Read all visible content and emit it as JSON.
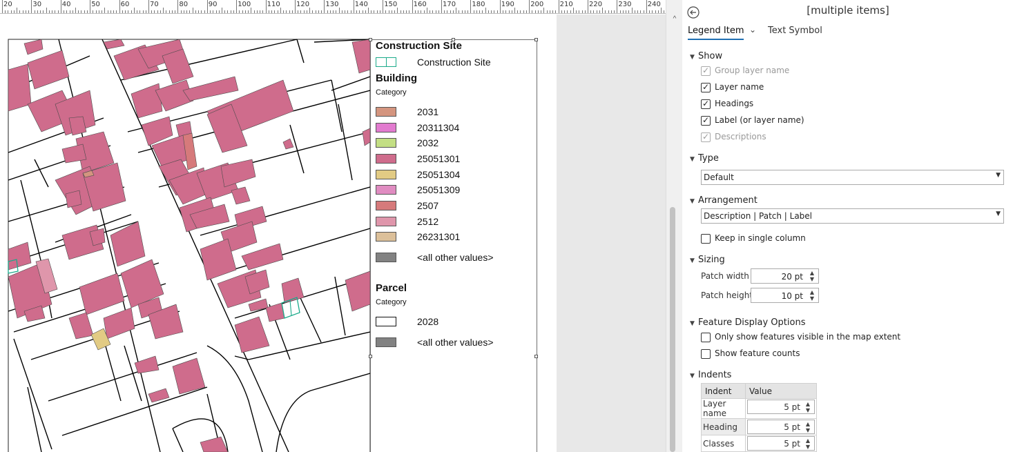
{
  "ruler": {
    "labels": [
      "20",
      "30",
      "40",
      "50",
      "60",
      "70",
      "80",
      "90",
      "100",
      "110",
      "120",
      "130",
      "140",
      "150",
      "160",
      "170",
      "180",
      "190",
      "200",
      "210",
      "220",
      "230",
      "240"
    ]
  },
  "legend": {
    "construction_title": "Construction Site",
    "construction_item": "Construction Site",
    "building_title": "Building",
    "building_heading": "Category",
    "building_items": [
      {
        "label": "2031",
        "color": "#d4957f"
      },
      {
        "label": "20311304",
        "color": "#e27bcf"
      },
      {
        "label": "2032",
        "color": "#c3df84"
      },
      {
        "label": "25051301",
        "color": "#cf6c8c"
      },
      {
        "label": "25051304",
        "color": "#e2cb84"
      },
      {
        "label": "25051309",
        "color": "#e08cc1"
      },
      {
        "label": "2507",
        "color": "#d67a7b"
      },
      {
        "label": "2512",
        "color": "#df96ab"
      },
      {
        "label": "26231301",
        "color": "#dcc09a"
      },
      {
        "label": "<all other values>",
        "color": "#828282"
      }
    ],
    "parcel_title": "Parcel",
    "parcel_heading": "Category",
    "parcel_items": [
      {
        "label": "2028",
        "color": "#ffffff"
      },
      {
        "label": "<all other values>",
        "color": "#828282"
      }
    ]
  },
  "pane": {
    "title": "[multiple items]",
    "tabs": {
      "legend_item": "Legend Item",
      "text_symbol": "Text Symbol"
    },
    "show": {
      "heading": "Show",
      "group_layer_name": "Group layer name",
      "layer_name": "Layer name",
      "headings": "Headings",
      "label": "Label (or layer name)",
      "descriptions": "Descriptions"
    },
    "type": {
      "heading": "Type",
      "value": "Default"
    },
    "arrangement": {
      "heading": "Arrangement",
      "value": "Description | Patch | Label",
      "keep_single": "Keep in single column"
    },
    "sizing": {
      "heading": "Sizing",
      "patch_width_label": "Patch width",
      "patch_width": "20 pt",
      "patch_height_label": "Patch height",
      "patch_height": "10 pt"
    },
    "feature_display": {
      "heading": "Feature Display Options",
      "only_visible": "Only show features visible in the map extent",
      "show_counts": "Show feature counts"
    },
    "indents": {
      "heading": "Indents",
      "col_indent": "Indent",
      "col_value": "Value",
      "rows": [
        {
          "name": "Layer name",
          "value": "5 pt"
        },
        {
          "name": "Heading",
          "value": "5 pt"
        },
        {
          "name": "Classes",
          "value": "5 pt"
        }
      ]
    }
  }
}
